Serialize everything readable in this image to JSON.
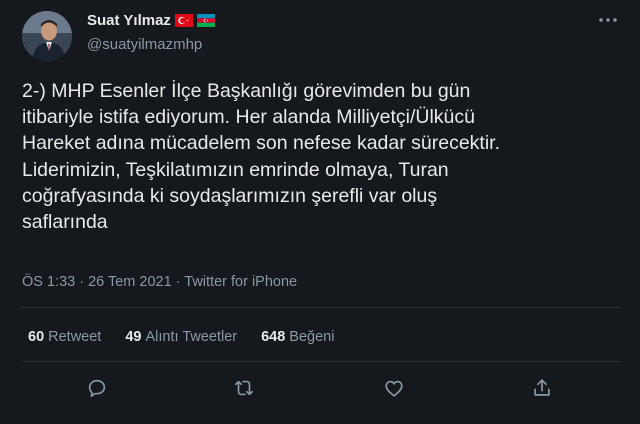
{
  "author": {
    "name": "Suat Yılmaz",
    "handle": "@suatyilmazmhp",
    "flags": [
      "turkey-flag-icon",
      "azerbaijan-flag-icon"
    ]
  },
  "tweet": {
    "lines": [
      "2-) MHP Esenler İlçe Başkanlığı görevimden bu gün",
      "itibariyle istifa ediyorum. Her alanda Milliyetçi/Ülkücü",
      "Hareket adına mücadelem son nefese kadar sürecektir.",
      "Liderimizin, Teşkilatımızın emrinde olmaya, Turan",
      "coğrafyasında ki soydaşlarımızın şerefli var oluş",
      "saflarında"
    ],
    "meta": "ÖS 1:33 · 26 Tem 2021 · Twitter for iPhone"
  },
  "stats": [
    {
      "count": "60",
      "label": "Retweet"
    },
    {
      "count": "49",
      "label": "Alıntı Tweetler"
    },
    {
      "count": "648",
      "label": "Beğeni"
    }
  ],
  "actions": [
    "reply-icon",
    "retweet-icon",
    "like-icon",
    "share-icon"
  ],
  "colors": {
    "background": "#15181c",
    "text": "#e7e9ea",
    "secondary": "#8b98a5",
    "divider": "#2f3336",
    "turkey_red": "#e30a17",
    "az_blue": "#0092bc",
    "az_red": "#e4002b",
    "az_green": "#00af50"
  }
}
